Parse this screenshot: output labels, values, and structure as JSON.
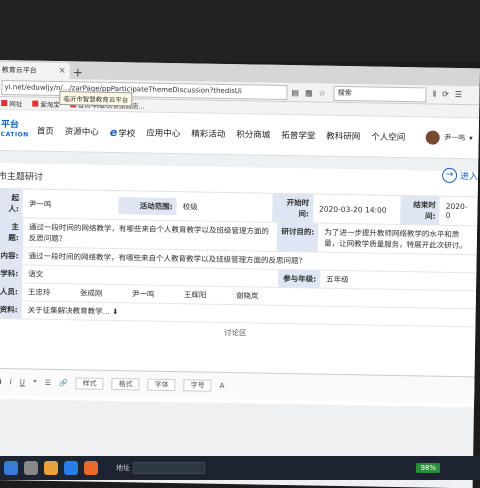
{
  "browser": {
    "tab_title": "教育云平台",
    "tooltip": "临沂市智慧教育云平台",
    "url": "yi.net/eduwljy/n/.../zarPage/ppParticipateThemeDiscussion?thedisUi",
    "search_placeholder": "搜索",
    "bookmarks": [
      "网址",
      "爱淘宝",
      "首页-韩都衣舍旗舰店..."
    ]
  },
  "site": {
    "logo_line1": "平台",
    "logo_line2": "CATION",
    "nav": [
      "首页",
      "资源中心",
      "学校",
      "应用中心",
      "精彩活动",
      "积分商城",
      "拓普学堂",
      "教科研网",
      "个人空间"
    ],
    "nav_e_prefix": "e",
    "user_name": "尹一鸣",
    "enter_label": "进入"
  },
  "page": {
    "title": "市主题研讨",
    "fields": {
      "initiator_label": "起人:",
      "initiator": "尹一鸣",
      "scope_label": "活动范围:",
      "scope": "校级",
      "start_label": "开始时间:",
      "start": "2020-03-20 14:00",
      "end_label": "结束时间:",
      "end": "2020-0",
      "theme_label": "主题:",
      "theme": "通过一段时间的网络教学，有哪些来自个人教育教学以及班级管理方面的反思问题？",
      "purpose_label": "研讨目的:",
      "purpose": "为了进一步提升教师网络教学的水平和质量，让网教学质量服务，特展开此次研讨。",
      "content_label": "内容:",
      "content": "通过一段时间的网络教学，有哪些来自个人教育教学以及班级管理方面的反思问题？",
      "subject_label": "学科:",
      "subject": "语文",
      "grade_label": "参与年级:",
      "grade": "五年级",
      "members_label": "人员:",
      "members": [
        "王忠玲",
        "张成刚",
        "尹一鸣",
        "王辉阳",
        "谢晓岚"
      ],
      "material_label": "资料:",
      "material": "关于征集解决教育教学..."
    },
    "discussion_label": "讨论区",
    "editor": [
      "B",
      "I",
      "U",
      "样式",
      "格式",
      "字体",
      "字号",
      "A"
    ]
  },
  "taskbar": {
    "address_label": "地址",
    "battery": "98%"
  }
}
